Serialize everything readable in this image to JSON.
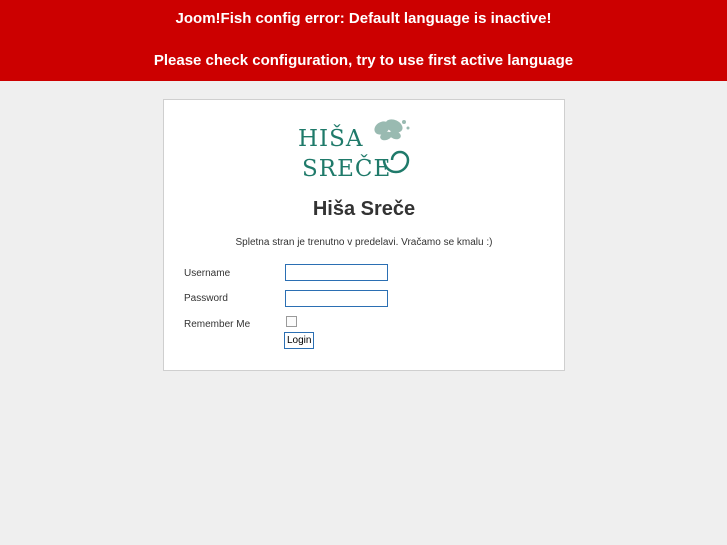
{
  "error": {
    "line1": "Joom!Fish config error: Default language is inactive!",
    "line2": "Please check configuration, try to use first active language",
    "background_color": "#cc0000",
    "text_color": "#ffffff"
  },
  "logo": {
    "line1": "HIŠA",
    "line2": "SREČE",
    "icon": "butterfly-icon",
    "color": "#1f7a6a"
  },
  "site": {
    "title": "Hiša Sreče",
    "offline_message": "Spletna stran je trenutno v predelavi. Vračamo se kmalu :)"
  },
  "form": {
    "username_label": "Username",
    "username_value": "",
    "password_label": "Password",
    "password_value": "",
    "remember_label": "Remember Me",
    "remember_checked": false,
    "login_label": "Login"
  }
}
